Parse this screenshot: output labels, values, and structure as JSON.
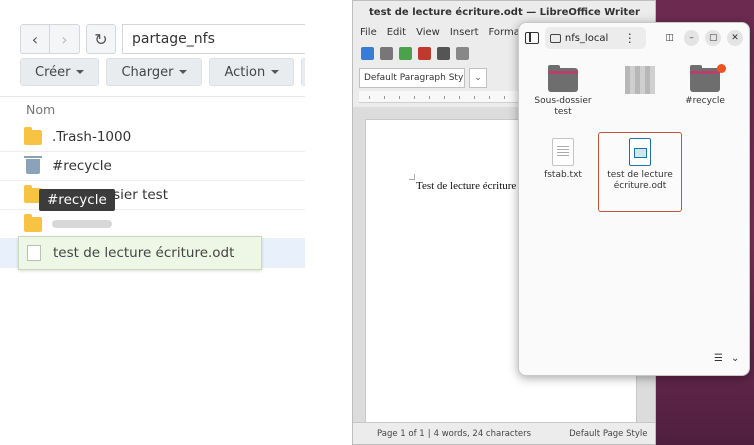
{
  "web_fm": {
    "path": "partage_nfs",
    "toolbar": {
      "create": "Créer",
      "upload": "Charger",
      "action": "Action"
    },
    "column_name": "Nom",
    "rows": [
      {
        "name": ".Trash-1000",
        "type": "folder"
      },
      {
        "name": "#recycle",
        "type": "trash"
      },
      {
        "name": "Sous-dossier test",
        "type": "folder"
      }
    ],
    "tooltip": "#recycle",
    "drag_item": "test de lecture écriture.odt"
  },
  "writer": {
    "title": "test de lecture écriture.odt — LibreOffice Writer",
    "menu": [
      "File",
      "Edit",
      "View",
      "Insert",
      "Format"
    ],
    "paragraph_style": "Default Paragraph Style",
    "document_text": "Test de lecture écriture",
    "status": {
      "page": "Page 1 of 1",
      "words": "4 words, 24 characters",
      "page_style": "Default Page Style"
    }
  },
  "files": {
    "location": "nfs_local",
    "items": {
      "subfolder": "Sous-dossier test",
      "recycle": "#recycle",
      "fstab": "fstab.txt",
      "odt": "test de lecture écriture.odt"
    }
  },
  "colors": {
    "accent_folder": "#f6c343",
    "ubuntu_orange": "#e95420",
    "desktop": "#7c3159"
  }
}
